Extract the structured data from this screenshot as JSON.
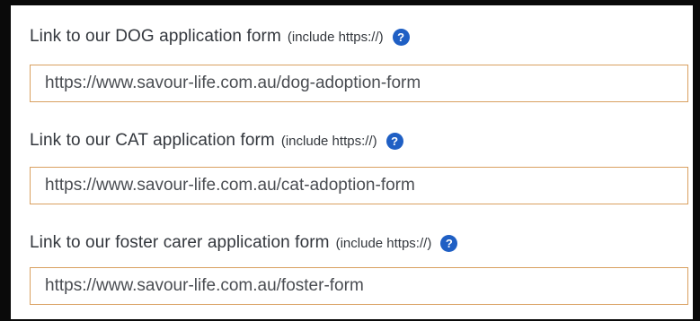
{
  "fields": [
    {
      "label": "Link to our DOG application form",
      "hint": "(include https://)",
      "help_icon": "?",
      "value": "https://www.savour-life.com.au/dog-adoption-form"
    },
    {
      "label": "Link to our CAT application form",
      "hint": "(include https://)",
      "help_icon": "?",
      "value": "https://www.savour-life.com.au/cat-adoption-form"
    },
    {
      "label": "Link to our foster carer application form",
      "hint": "(include https://)",
      "help_icon": "?",
      "value": "https://www.savour-life.com.au/foster-form"
    }
  ],
  "colors": {
    "frame": "#0a0a0a",
    "input_border": "#d9a060",
    "help_icon_bg": "#1f5fc4",
    "label_text": "#33373d"
  }
}
